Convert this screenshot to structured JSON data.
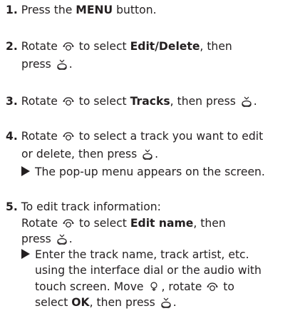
{
  "steps": [
    {
      "num": "1.",
      "segments": [
        [
          "Press the "
        ],
        [
          "MENU",
          "bold"
        ],
        [
          " button."
        ]
      ]
    },
    {
      "num": "2.",
      "segments": [
        [
          "Rotate "
        ],
        [
          "rotate-knob-icon",
          "icon"
        ],
        [
          " to select "
        ],
        [
          "Edit/Delete",
          "bold"
        ],
        [
          ", then press "
        ],
        [
          "press-knob-icon",
          "icon"
        ],
        [
          "."
        ]
      ]
    },
    {
      "num": "3.",
      "segments": [
        [
          "Rotate "
        ],
        [
          "rotate-knob-icon",
          "icon"
        ],
        [
          " to select "
        ],
        [
          "Tracks",
          "bold"
        ],
        [
          ", then press "
        ],
        [
          "press-knob-icon",
          "icon"
        ],
        [
          "."
        ]
      ]
    },
    {
      "num": "4.",
      "segments": [
        [
          "Rotate "
        ],
        [
          "rotate-knob-icon",
          "icon"
        ],
        [
          " to select a track you want to edit or delete, then press "
        ],
        [
          "press-knob-icon",
          "icon"
        ],
        [
          "."
        ]
      ],
      "result": "The pop-up menu appears on the screen."
    },
    {
      "num": "5.",
      "segments": [
        [
          "To edit track information:"
        ]
      ],
      "sub": [
        [
          "Rotate "
        ],
        [
          "rotate-knob-icon",
          "icon"
        ],
        [
          " to select "
        ],
        [
          "Edit name",
          "bold"
        ],
        [
          ", then press "
        ],
        [
          "press-knob-icon",
          "icon"
        ],
        [
          "."
        ]
      ],
      "result_segments": [
        [
          "Enter the track name, track artist, etc. using the interface dial or the audio with touch screen. Move "
        ],
        [
          "move-knob-icon",
          "icon"
        ],
        [
          ", rotate "
        ],
        [
          "rotate-knob-icon",
          "icon"
        ],
        [
          " to select "
        ],
        [
          "OK",
          "bold"
        ],
        [
          ", then press "
        ],
        [
          "press-knob-icon",
          "icon"
        ],
        [
          "."
        ]
      ]
    }
  ],
  "text": {
    "s1_num": "1.",
    "s1_a": "Press the ",
    "s1_b": "MENU",
    "s1_c": " button.",
    "s2_num": "2.",
    "s2_a": "Rotate ",
    "s2_b": " to select ",
    "s2_c": "Edit/Delete",
    "s2_d": ", then",
    "s2_e": "press ",
    "s2_f": ".",
    "s3_num": "3.",
    "s3_a": "Rotate ",
    "s3_b": " to select ",
    "s3_c": "Tracks",
    "s3_d": ", then press ",
    "s3_e": ".",
    "s4_num": "4.",
    "s4_a": "Rotate ",
    "s4_b": " to select a track you want to edit",
    "s4_c": "or delete, then press ",
    "s4_d": ".",
    "s4_res": "The pop-up menu appears on the screen.",
    "s5_num": "5.",
    "s5_a": "To edit track information:",
    "s5_b": "Rotate ",
    "s5_c": " to select ",
    "s5_d": "Edit name",
    "s5_e": ", then",
    "s5_f": "press ",
    "s5_g": ".",
    "s5_r1": "Enter the track name, track artist, etc.",
    "s5_r2": "using the interface dial or the audio with",
    "s5_r3a": "touch screen. Move ",
    "s5_r3b": ", rotate ",
    "s5_r3c": " to",
    "s5_r4a": "select ",
    "s5_r4b": "OK",
    "s5_r4c": ", then press ",
    "s5_r4d": "."
  }
}
